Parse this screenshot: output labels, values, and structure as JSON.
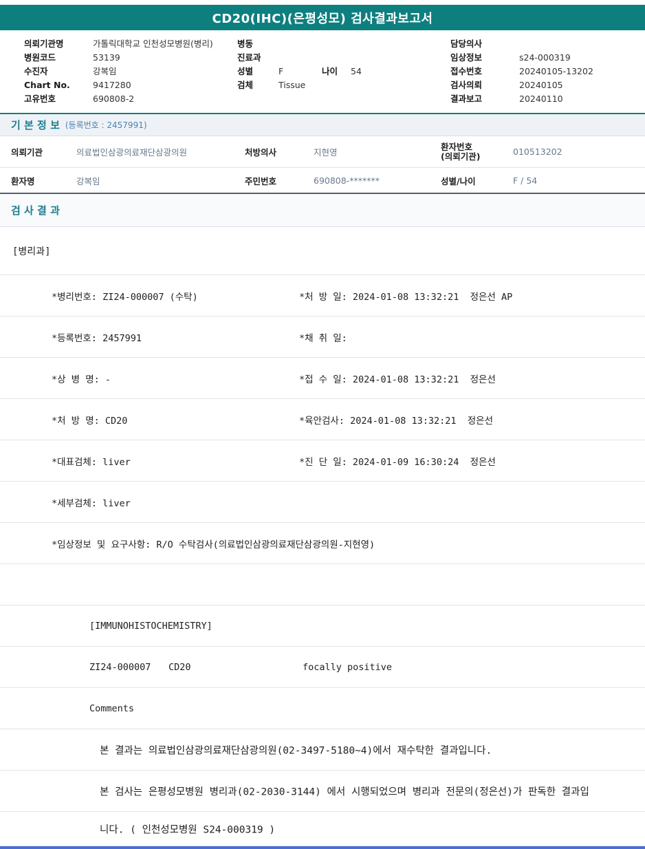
{
  "title": "CD20(IHC)(은평성모) 검사결과보고서",
  "header": {
    "left": [
      {
        "label": "의뢰기관명",
        "value": "가톨릭대학교 인천성모병원(병리)"
      },
      {
        "label": "병원코드",
        "value": "53139"
      },
      {
        "label": "수진자",
        "value": "강복임"
      },
      {
        "label": "Chart No.",
        "value": "9417280"
      },
      {
        "label": "고유번호",
        "value": "690808-2"
      }
    ],
    "middle": {
      "ward_label": "병동",
      "ward_value": "",
      "dept_label": "진료과",
      "dept_value": "",
      "sex_label": "성별",
      "sex_value": "F",
      "age_label": "나이",
      "age_value": "54",
      "specimen_label": "검체",
      "specimen_value": "Tissue"
    },
    "right": [
      {
        "label": "담당의사",
        "value": ""
      },
      {
        "label": "임상정보",
        "value": "s24-000319"
      },
      {
        "label": "접수번호",
        "value": "20240105-13202"
      },
      {
        "label": "검사의뢰",
        "value": "20240105"
      },
      {
        "label": "결과보고",
        "value": "20240110"
      }
    ]
  },
  "basic_info": {
    "section_title": "기 본 정 보",
    "reg_note": "(등록번호 : 2457991)",
    "row1": [
      {
        "label": "의뢰기관",
        "value": "의료법인삼광의료재단삼광의원"
      },
      {
        "label": "처방의사",
        "value": "지현영"
      },
      {
        "label": "환자번호",
        "label2": "(의뢰기관)",
        "value": "010513202"
      }
    ],
    "row2": [
      {
        "label": "환자명",
        "value": "강복임"
      },
      {
        "label": "주민번호",
        "value": "690808-*******"
      },
      {
        "label": "성별/나이",
        "value": "F / 54"
      }
    ]
  },
  "results": {
    "section_title": "검 사 결 과",
    "department": "[병리과]",
    "detail_rows": [
      {
        "left": "*병리번호: ZI24-000007 (수탁)",
        "right": "*처 방 일: 2024-01-08 13:32:21  정은선 AP"
      },
      {
        "left": "*등록번호: 2457991",
        "right": "*채 취 일:"
      },
      {
        "left": "*상 병 명: -",
        "right": "*접 수 일: 2024-01-08 13:32:21  정은선"
      },
      {
        "left": "*처 방 명: CD20",
        "right": "*육안검사: 2024-01-08 13:32:21  정은선"
      },
      {
        "left": "*대표검체: liver",
        "right": "*진 단 일: 2024-01-09 16:30:24  정은선"
      },
      {
        "left": "*세부검체: liver",
        "right": ""
      },
      {
        "left": "*임상정보 및 요구사항: R/O 수탁검사(의료법인삼광의료재단삼광의원-지현영)",
        "right": ""
      }
    ],
    "ihc_header": "[IMMUNOHISTOCHEMISTRY]",
    "ihc_row": {
      "code": "ZI24-000007",
      "test": "CD20",
      "result": "focally positive"
    },
    "comments_label": "Comments",
    "comment_lines": [
      "본 결과는 의료법인삼광의료재단삼광의원(02-3497-5180~4)에서 재수탁한 결과입니다.",
      "본 검사는 은평성모병원 병리과(02-2030-3144) 에서 시행되었으며 병리과 전문의(정은선)가 판독한 결과입",
      "니다. ( 인천성모병원 S24-000319 )"
    ]
  }
}
